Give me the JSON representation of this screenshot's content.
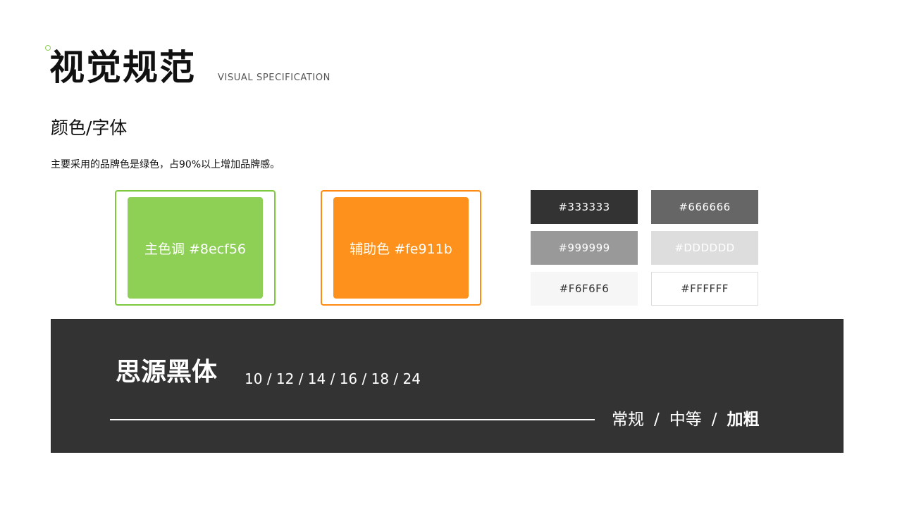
{
  "header": {
    "title": "视觉规范",
    "subtitle_en": "VISUAL SPECIFICATION"
  },
  "section": {
    "title": "颜色/字体",
    "description": "主要采用的品牌色是绿色，占90%以上增加品牌感。"
  },
  "colors": {
    "primary": {
      "label": "主色调 #8ecf56",
      "hex": "#8ecf56",
      "border": "#7cc83f"
    },
    "secondary": {
      "label": "辅助色 #fe911b",
      "hex": "#fe911b",
      "border": "#fe8a12"
    }
  },
  "grays": [
    {
      "label": "#333333",
      "bg": "#333333",
      "text": "#ffffff"
    },
    {
      "label": "#666666",
      "bg": "#666666",
      "text": "#ffffff"
    },
    {
      "label": "#999999",
      "bg": "#999999",
      "text": "#ffffff"
    },
    {
      "label": "#DDDDDD",
      "bg": "#dddddd",
      "text": "#ffffff"
    },
    {
      "label": "#F6F6F6",
      "bg": "#f6f6f6",
      "text": "#333333"
    },
    {
      "label": "#FFFFFF",
      "bg": "#ffffff",
      "text": "#333333"
    }
  ],
  "font": {
    "name": "思源黑体",
    "sizes": "10 / 12 / 14 / 16 / 18 / 24",
    "weights": [
      "常规",
      "中等",
      "加粗"
    ],
    "separator": "/",
    "panel_bg": "#333333"
  }
}
